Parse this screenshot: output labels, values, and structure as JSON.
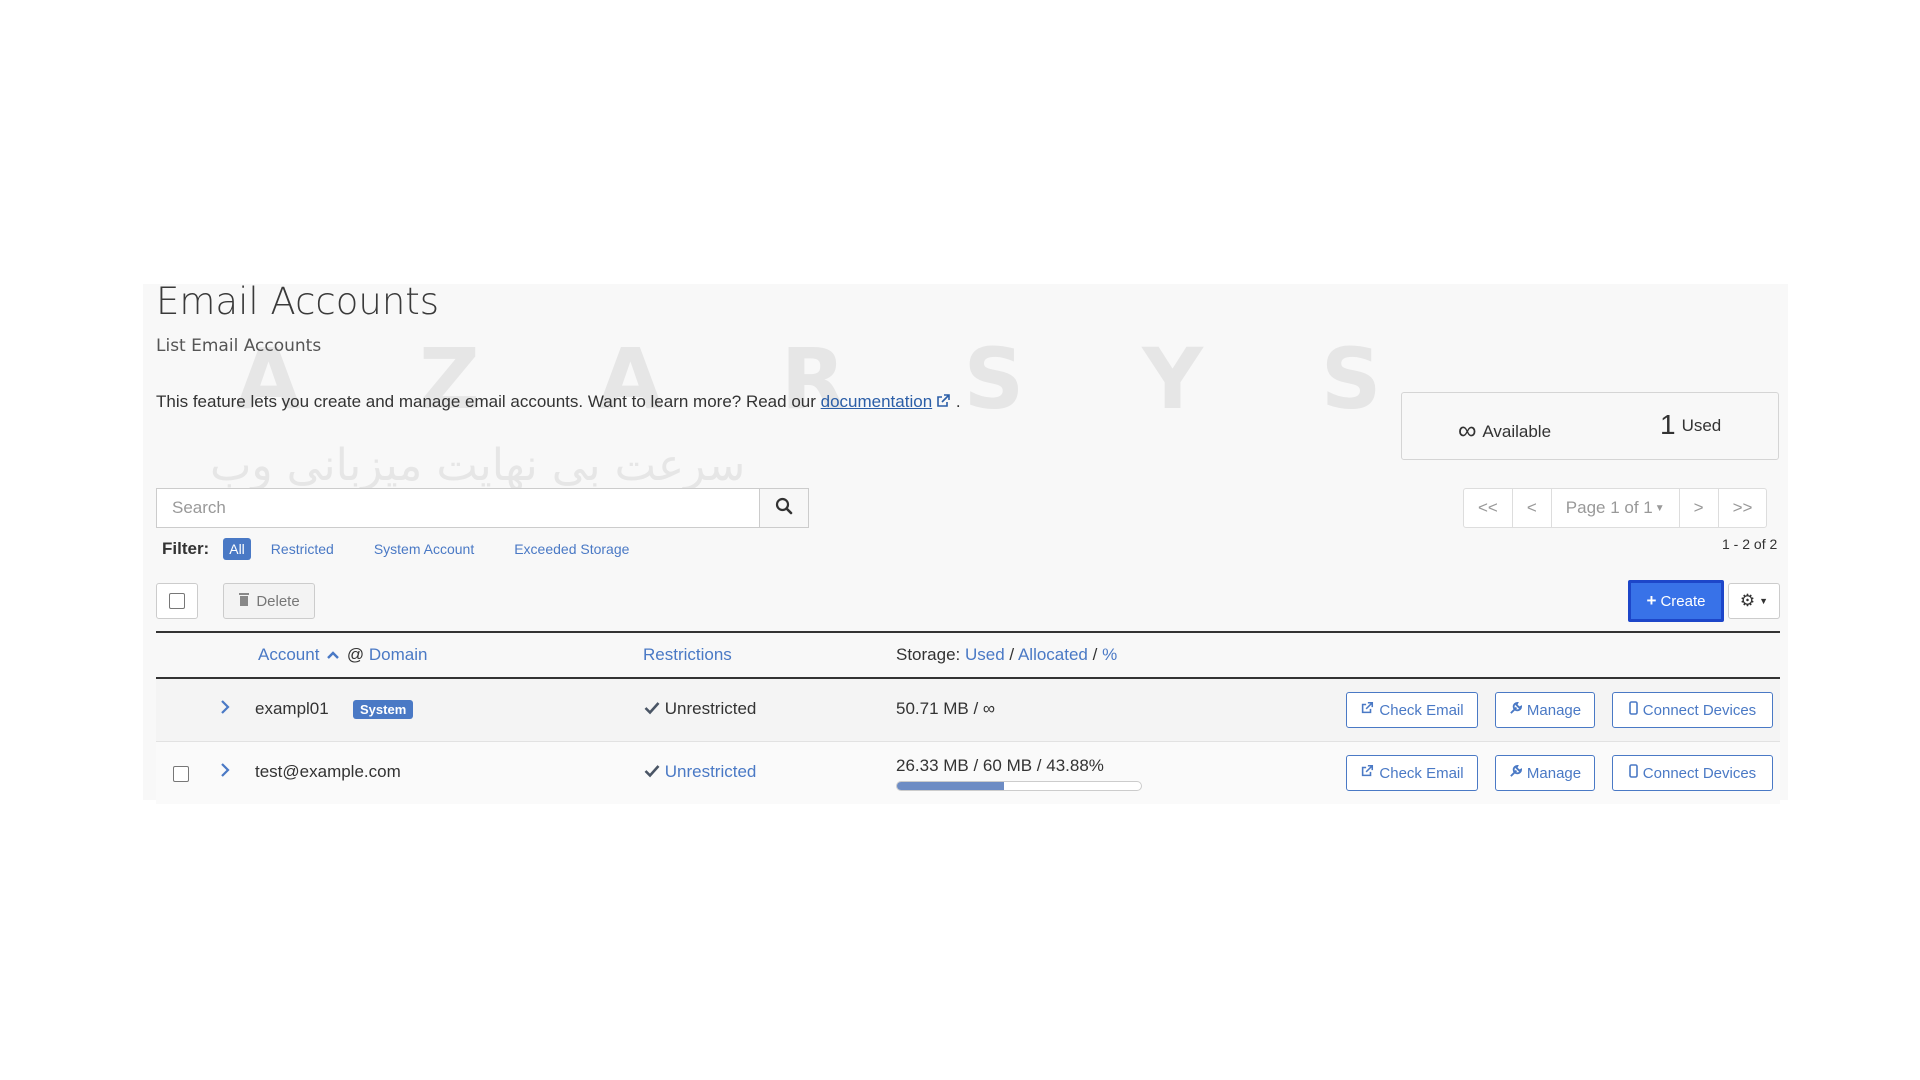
{
  "page": {
    "title": "Email Accounts",
    "subtitle": "List Email Accounts",
    "description": "This feature lets you create and manage email accounts. Want to learn more? Read our",
    "doc_link": "documentation",
    "doc_suffix": "."
  },
  "stats": {
    "available_symbol": "∞",
    "available_label": "Available",
    "used_count": "1",
    "used_label": "Used"
  },
  "search": {
    "placeholder": "Search"
  },
  "pagination": {
    "first": "<<",
    "prev": "<",
    "page_label": "Page 1 of 1",
    "next": ">",
    "last": ">>",
    "range": "1 - 2 of 2"
  },
  "filter": {
    "label": "Filter:",
    "options": [
      "All",
      "Restricted",
      "System Account",
      "Exceeded Storage"
    ],
    "selected": "All"
  },
  "toolbar": {
    "delete_label": "Delete",
    "create_label": "Create"
  },
  "table": {
    "headers": {
      "account": "Account",
      "at": "@",
      "domain": "Domain",
      "restrictions": "Restrictions",
      "storage_prefix": "Storage:",
      "used": "Used",
      "allocated": "Allocated",
      "percent": "%",
      "sep": "/"
    },
    "rows": [
      {
        "account": "exampl01",
        "badge": "System",
        "restriction": "Unrestricted",
        "storage": "50.71 MB / ∞",
        "check_email": "Check Email",
        "manage": "Manage",
        "connect": "Connect Devices"
      },
      {
        "account": "test@example.com",
        "restriction": "Unrestricted",
        "storage": "26.33 MB / 60 MB / 43.88%",
        "usage_percent": 43.88,
        "check_email": "Check Email",
        "manage": "Manage",
        "connect": "Connect Devices"
      }
    ]
  },
  "watermark": {
    "letters": "AZARSYS",
    "script": "سرعت بی نهایت میزبانی وب"
  },
  "colors": {
    "accent": "#4a79c5",
    "create": "#3872e8"
  }
}
